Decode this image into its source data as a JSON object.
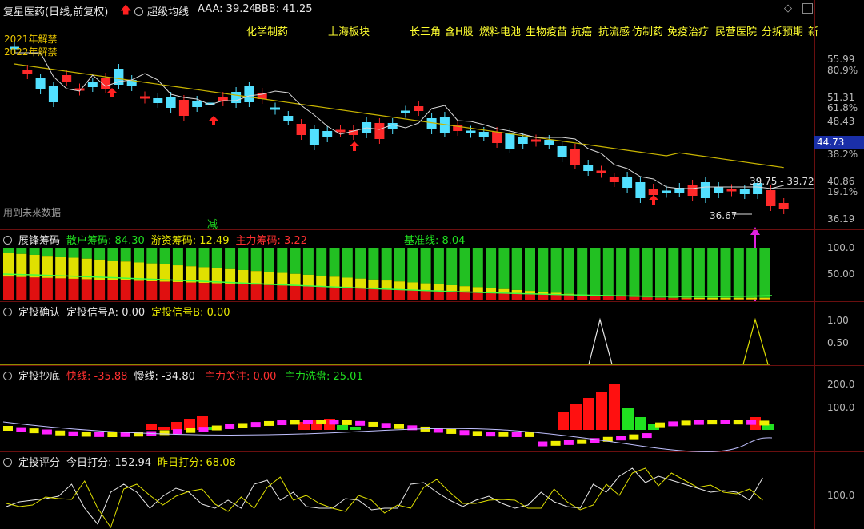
{
  "header": {
    "stock": "复星医药(日线,前复权)",
    "indicator": "超级均线",
    "aaa": "AAA: 39.24",
    "bbb": "BBB: 41.25",
    "tags": [
      "化学制药",
      "上海板块",
      "长三角",
      "含H股",
      "燃料电池",
      "生物疫苗",
      "抗癌",
      "抗流感",
      "仿制药",
      "免疫治疗",
      "民营医院",
      "分拆预期",
      "新"
    ]
  },
  "main": {
    "notes": [
      "2021年解禁",
      "2022年解禁"
    ],
    "future_note": "用到未来数据",
    "jian": "减",
    "range_label": "39.75 - 39.72",
    "low_label": "36.67",
    "price_ticks": [
      "55.99",
      "51.31",
      "48.43",
      "40.86",
      "36.19"
    ],
    "pct_ticks": [
      "80.9%",
      "61.8%",
      "38.2%",
      "19.1%"
    ],
    "current_price": "44.73",
    "colors": {
      "up": "#ff2a2a",
      "down": "#52e0ff",
      "ma_yellow": "#c8b400",
      "ma_white": "#d8d8d8"
    }
  },
  "panel1": {
    "name": "展锋筹码",
    "a": "散户筹码: 84.30",
    "b": "游资筹码: 12.49",
    "c": "主力筹码: 3.22",
    "d": "基准线: 8.04",
    "ticks": [
      "100.0",
      "50.00"
    ]
  },
  "panel2": {
    "name": "定投确认",
    "a": "定投信号A: 0.00",
    "b": "定投信号B: 0.00",
    "ticks": [
      "1.00",
      "0.50"
    ]
  },
  "panel3": {
    "name": "定投抄底",
    "a": "快线: -35.88",
    "b": "慢线: -34.80",
    "c": "主力关注: 0.00",
    "d": "主力洗盘: 25.01",
    "ticks": [
      "200.0",
      "100.0"
    ]
  },
  "panel4": {
    "name": "定投评分",
    "a": "今日打分: 152.94",
    "b": "昨日打分: 68.08",
    "ticks": [
      "100.0"
    ]
  }
}
